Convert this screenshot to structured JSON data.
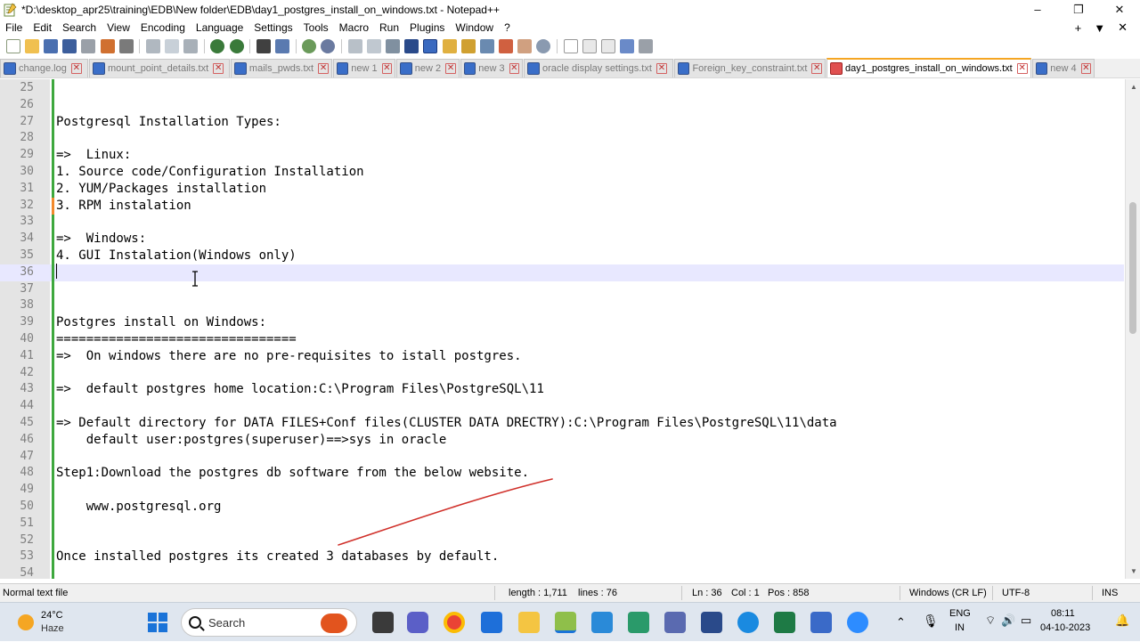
{
  "window": {
    "title": "*D:\\desktop_apr25\\training\\EDB\\New folder\\EDB\\day1_postgres_install_on_windows.txt - Notepad++",
    "controls": [
      "–",
      "❐",
      "✕"
    ]
  },
  "menu": {
    "items": [
      "File",
      "Edit",
      "Search",
      "View",
      "Encoding",
      "Language",
      "Settings",
      "Tools",
      "Macro",
      "Run",
      "Plugins",
      "Window",
      "?"
    ],
    "right": [
      "+",
      "▼",
      "✕"
    ]
  },
  "tabs": [
    {
      "label": "change.log",
      "active": false
    },
    {
      "label": "mount_point_details.txt",
      "active": false
    },
    {
      "label": "mails_pwds.txt",
      "active": false
    },
    {
      "label": "new 1",
      "active": false
    },
    {
      "label": "new 2",
      "active": false
    },
    {
      "label": "new 3",
      "active": false
    },
    {
      "label": "oracle display settings.txt",
      "active": false
    },
    {
      "label": "Foreign_key_constraint.txt",
      "active": false
    },
    {
      "label": "day1_postgres_install_on_windows.txt",
      "active": true
    },
    {
      "label": "new 4",
      "active": false
    }
  ],
  "editor": {
    "lines": [
      {
        "n": "25",
        "text": ""
      },
      {
        "n": "26",
        "text": ""
      },
      {
        "n": "27",
        "text": "Postgresql Installation Types:"
      },
      {
        "n": "28",
        "text": ""
      },
      {
        "n": "29",
        "text": "=>  Linux:"
      },
      {
        "n": "30",
        "text": "1. Source code/Configuration Installation"
      },
      {
        "n": "31",
        "text": "2. YUM/Packages installation"
      },
      {
        "n": "32",
        "text": "3. RPM instalation"
      },
      {
        "n": "33",
        "text": ""
      },
      {
        "n": "34",
        "text": "=>  Windows:"
      },
      {
        "n": "35",
        "text": "4. GUI Instalation(Windows only)"
      },
      {
        "n": "36",
        "text": ""
      },
      {
        "n": "37",
        "text": ""
      },
      {
        "n": "38",
        "text": ""
      },
      {
        "n": "39",
        "text": "Postgres install on Windows:"
      },
      {
        "n": "40",
        "text": "================================"
      },
      {
        "n": "41",
        "text": "=>  On windows there are no pre-requisites to istall postgres."
      },
      {
        "n": "42",
        "text": ""
      },
      {
        "n": "43",
        "text": "=>  default postgres home location:C:\\Program Files\\PostgreSQL\\11"
      },
      {
        "n": "44",
        "text": ""
      },
      {
        "n": "45",
        "text": "=> Default directory for DATA FILES+Conf files(CLUSTER DATA DRECTRY):C:\\Program Files\\PostgreSQL\\11\\data"
      },
      {
        "n": "46",
        "text": "    default user:postgres(superuser)==>sys in oracle"
      },
      {
        "n": "47",
        "text": ""
      },
      {
        "n": "48",
        "text": "Step1:Download the postgres db software from the below website."
      },
      {
        "n": "49",
        "text": ""
      },
      {
        "n": "50",
        "text": "    www.postgresql.org"
      },
      {
        "n": "51",
        "text": ""
      },
      {
        "n": "52",
        "text": ""
      },
      {
        "n": "53",
        "text": "Once installed postgres its created 3 databases by default."
      },
      {
        "n": "54",
        "text": ""
      }
    ],
    "current_line": "36"
  },
  "status": {
    "file_type": "Normal text file",
    "length": "length : 1,711",
    "lines": "lines : 76",
    "ln": "Ln : 36",
    "col": "Col : 1",
    "pos": "Pos : 858",
    "eol": "Windows (CR LF)",
    "encoding": "UTF-8",
    "mode": "INS"
  },
  "taskbar": {
    "weather_temp": "24°C",
    "weather_cond": "Haze",
    "search_placeholder": "Search",
    "lang_line1": "ENG",
    "lang_line2": "IN",
    "time": "08:11",
    "date": "04-10-2023"
  },
  "colors": {
    "accent_tab": "#f5a623",
    "change_bar": "#3ea83e",
    "current_line": "#e8e8ff",
    "annotation": "#d0302a"
  }
}
